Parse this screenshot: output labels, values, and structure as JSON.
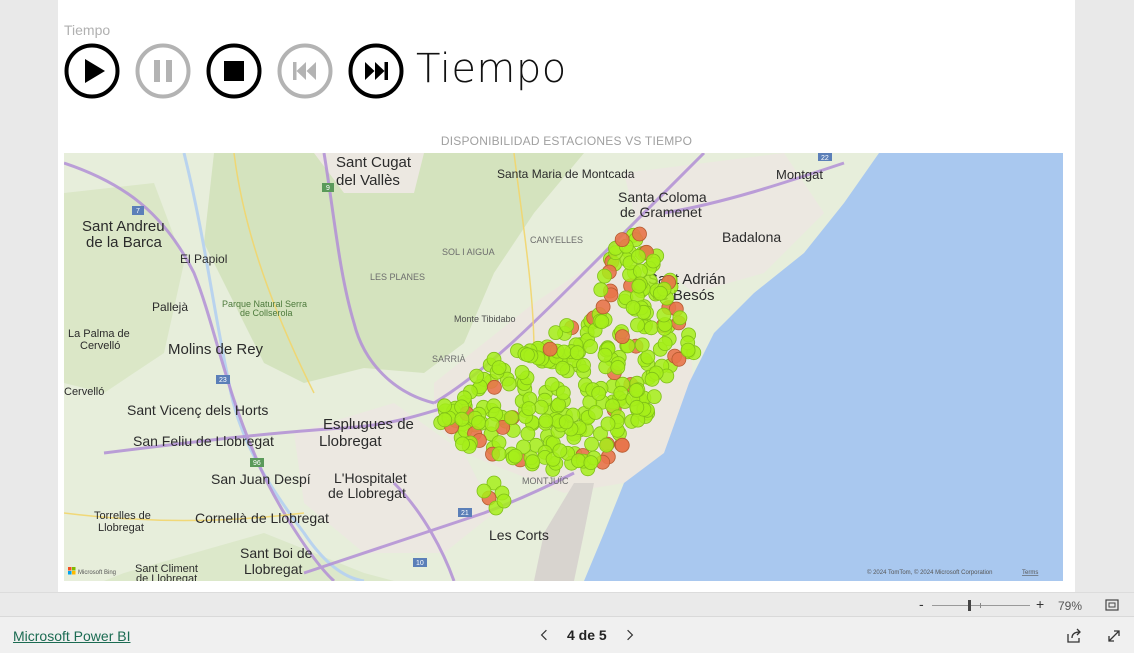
{
  "slicer": {
    "header": "Tiempo",
    "title": "Tiempo",
    "buttons": [
      {
        "name": "play",
        "icon": "play-icon",
        "enabled": true
      },
      {
        "name": "pause",
        "icon": "pause-icon",
        "enabled": false
      },
      {
        "name": "stop",
        "icon": "stop-icon",
        "enabled": true
      },
      {
        "name": "previous",
        "icon": "skip-back-icon",
        "enabled": false
      },
      {
        "name": "next",
        "icon": "skip-forward-icon",
        "enabled": true
      }
    ]
  },
  "map": {
    "title": "DISPONIBILIDAD ESTACIONES VS TIEMPO",
    "attribution": "© 2024 TomTom, © 2024 Microsoft Corporation",
    "terms": "Terms",
    "brand": "Microsoft Bing",
    "labels": [
      {
        "id": "sant-cugat",
        "text": "Sant Cugat"
      },
      {
        "id": "del-valles",
        "text": "del Vallès"
      },
      {
        "id": "santa-maria",
        "text": "Santa Maria de Montcada"
      },
      {
        "id": "montgat",
        "text": "Montgat"
      },
      {
        "id": "santa-coloma",
        "text": "Santa Coloma"
      },
      {
        "id": "de-gramenet",
        "text": "de Gramenet"
      },
      {
        "id": "sant-andreu",
        "text": "Sant Andreu"
      },
      {
        "id": "de-la-barca",
        "text": "de la Barca"
      },
      {
        "id": "badalona",
        "text": "Badalona"
      },
      {
        "id": "canyelles",
        "text": "CANYELLES"
      },
      {
        "id": "sol-i-aigua",
        "text": "SOL I AIGUA"
      },
      {
        "id": "el-papiol",
        "text": "El Papiol"
      },
      {
        "id": "les-planes",
        "text": "LES PLANES"
      },
      {
        "id": "sant-adrian",
        "text": "Sant Adrián"
      },
      {
        "id": "de-besos",
        "text": "de Besós"
      },
      {
        "id": "pallejà",
        "text": "Pallejà"
      },
      {
        "id": "parque1",
        "text": "Parque Natural Serra"
      },
      {
        "id": "parque2",
        "text": "de Collserola"
      },
      {
        "id": "la-palma1",
        "text": "La Palma de"
      },
      {
        "id": "la-palma2",
        "text": "Cervelló"
      },
      {
        "id": "molins",
        "text": "Molins de Rey"
      },
      {
        "id": "tibidabo",
        "text": "Monte Tibidabo"
      },
      {
        "id": "sarria",
        "text": "SARRIÀ"
      },
      {
        "id": "cervello",
        "text": "Cervelló"
      },
      {
        "id": "sant-vicenc",
        "text": "Sant Vicenç dels Horts"
      },
      {
        "id": "esplugues1",
        "text": "Esplugues de"
      },
      {
        "id": "esplugues2",
        "text": "Llobregat"
      },
      {
        "id": "sant-feliu",
        "text": "San Feliu de Llobregat"
      },
      {
        "id": "sant-joan",
        "text": "San Juan Despí"
      },
      {
        "id": "hospitalet1",
        "text": "L'Hospitalet"
      },
      {
        "id": "hospitalet2",
        "text": "de Llobregat"
      },
      {
        "id": "montjuic",
        "text": "MONTJUÏC"
      },
      {
        "id": "torrelles1",
        "text": "Torrelles de"
      },
      {
        "id": "torrelles2",
        "text": "Llobregat"
      },
      {
        "id": "cornella",
        "text": "Cornellà de Llobregat"
      },
      {
        "id": "les-corts",
        "text": "Les Corts"
      },
      {
        "id": "sant-boi1",
        "text": "Sant Boi de"
      },
      {
        "id": "sant-boi2",
        "text": "Llobregat"
      },
      {
        "id": "sant-climent1",
        "text": "Sant Climent"
      },
      {
        "id": "sant-climent2",
        "text": "de Llobregat"
      },
      {
        "id": "road-7",
        "text": "7"
      },
      {
        "id": "road-9",
        "text": "9"
      },
      {
        "id": "road-23",
        "text": "23"
      },
      {
        "id": "road-21",
        "text": "21"
      },
      {
        "id": "road-10",
        "text": "10"
      },
      {
        "id": "road-96",
        "text": "96"
      },
      {
        "id": "road-22",
        "text": "22"
      }
    ],
    "colors": {
      "available": "#a6ee1a",
      "empty": "#e8744a",
      "sea": "#a9c8ef",
      "land": "#e6efd9"
    }
  },
  "zoom": {
    "minus": "-",
    "plus": "+",
    "level": "79%"
  },
  "footer": {
    "brand_link": "Microsoft Power BI",
    "page_label": "4 de 5"
  }
}
